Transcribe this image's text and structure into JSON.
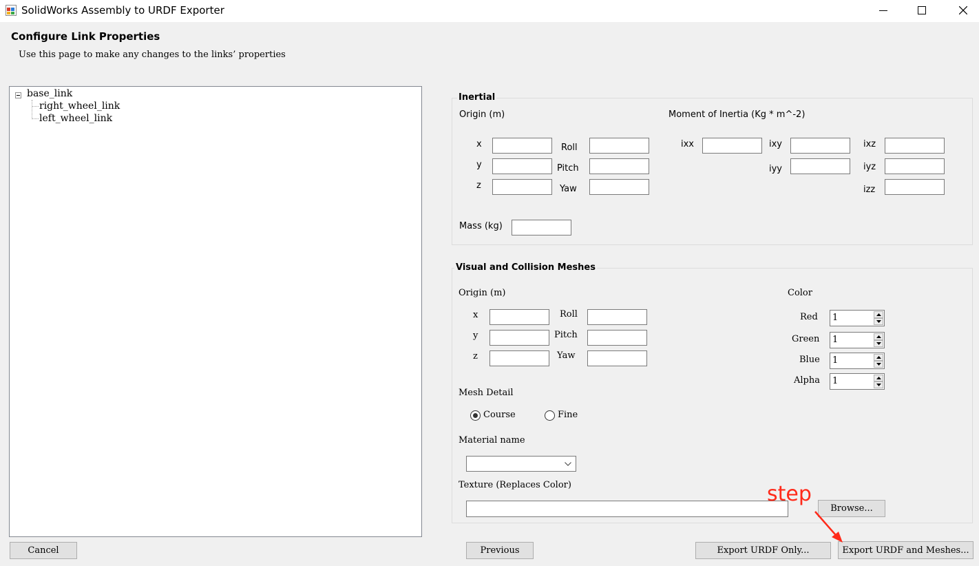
{
  "window": {
    "title": "SolidWorks Assembly to URDF Exporter",
    "controls": {
      "minimize": "minimize-icon",
      "maximize": "maximize-icon",
      "close": "close-icon"
    }
  },
  "header": {
    "title": "Configure Link Properties",
    "subtitle": "Use this page to make any changes to the links’ properties"
  },
  "tree": {
    "root": "base_link",
    "children": [
      "right_wheel_link",
      "left_wheel_link"
    ]
  },
  "inertial": {
    "group_label": "Inertial",
    "origin_label": "Origin (m)",
    "moment_label": "Moment of Inertia (Kg * m^-2)",
    "x_label": "x",
    "y_label": "y",
    "z_label": "z",
    "roll_label": "Roll",
    "pitch_label": "Pitch",
    "yaw_label": "Yaw",
    "x": "",
    "y": "",
    "z": "",
    "roll": "",
    "pitch": "",
    "yaw": "",
    "ixx_label": "ixx",
    "ixy_label": "ixy",
    "ixz_label": "ixz",
    "iyy_label": "iyy",
    "iyz_label": "iyz",
    "izz_label": "izz",
    "ixx": "",
    "ixy": "",
    "ixz": "",
    "iyy": "",
    "iyz": "",
    "izz": "",
    "mass_label": "Mass (kg)",
    "mass": ""
  },
  "visual": {
    "group_label": "Visual and Collision Meshes",
    "origin_label": "Origin (m)",
    "x_label": "x",
    "y_label": "y",
    "z_label": "z",
    "roll_label": "Roll",
    "pitch_label": "Pitch",
    "yaw_label": "Yaw",
    "x": "",
    "y": "",
    "z": "",
    "roll": "",
    "pitch": "",
    "yaw": "",
    "color_label": "Color",
    "red_label": "Red",
    "green_label": "Green",
    "blue_label": "Blue",
    "alpha_label": "Alpha",
    "red": "1",
    "green": "1",
    "blue": "1",
    "alpha": "1",
    "mesh_detail_label": "Mesh Detail",
    "course_label": "Course",
    "fine_label": "Fine",
    "mesh_detail_selected": "Course",
    "material_label": "Material name",
    "material_value": "",
    "texture_label": "Texture (Replaces Color)",
    "texture_value": "",
    "browse_label": "Browse..."
  },
  "buttons": {
    "cancel": "Cancel",
    "previous": "Previous",
    "export_urdf_only": "Export URDF Only...",
    "export_urdf_meshes": "Export URDF and Meshes..."
  },
  "annotation": {
    "text": "step",
    "color": "#ff2a1a"
  }
}
